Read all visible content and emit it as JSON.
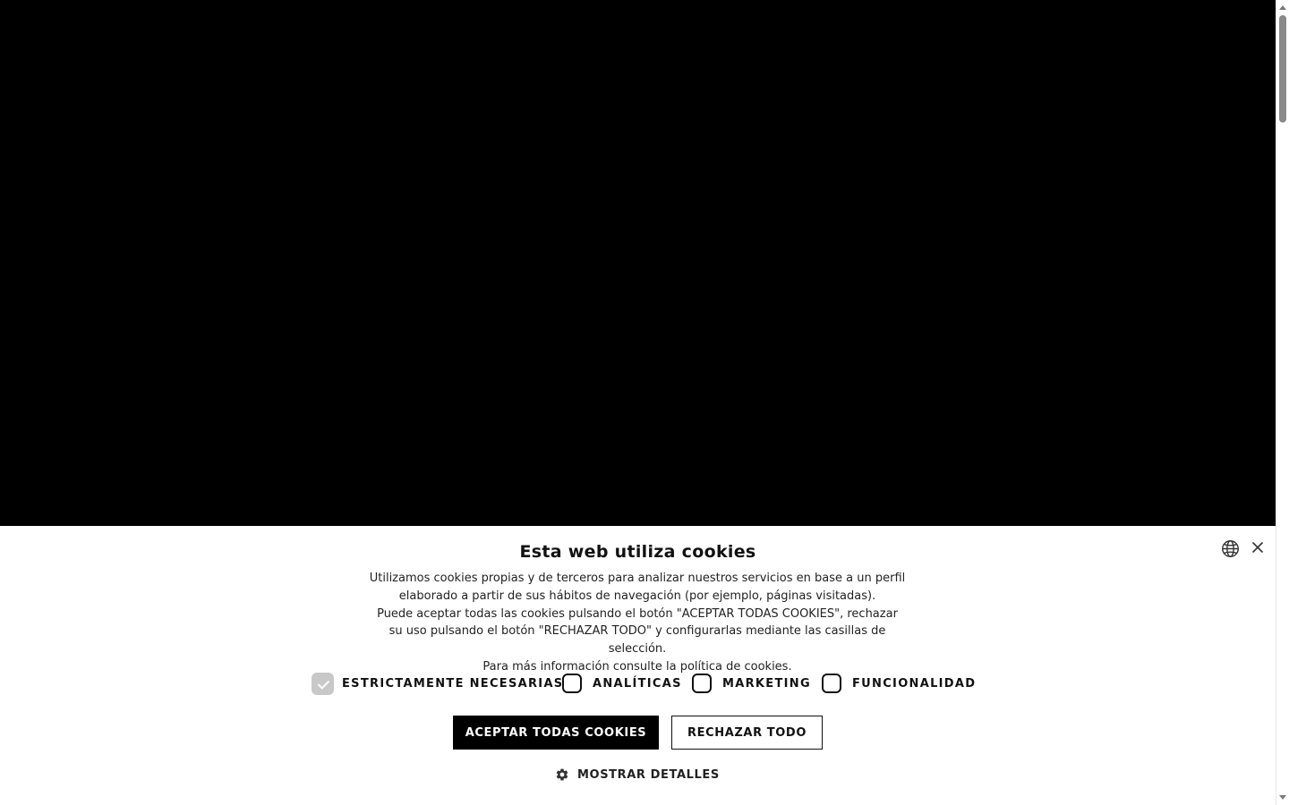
{
  "banner": {
    "title": "Esta web utiliza cookies",
    "paragraphs": [
      "Utilizamos cookies propias y de terceros para analizar nuestros servicios en base a un perfil elaborado a partir de sus hábitos de navegación (por ejemplo, páginas visitadas).",
      "Puede aceptar todas las cookies pulsando el botón \"ACEPTAR TODAS COOKIES\", rechazar su uso pulsando el botón \"RECHAZAR TODO\" y configurarlas mediante las casillas de selección.",
      "Para más información consulte la política de cookies."
    ],
    "language_icon": "globe-icon",
    "close_icon": "close-icon"
  },
  "categories": [
    {
      "label": "ESTRICTAMENTE NECESARIAS",
      "checked": true,
      "disabled": true
    },
    {
      "label": "ANALÍTICAS",
      "checked": false,
      "disabled": false
    },
    {
      "label": "MARKETING",
      "checked": false,
      "disabled": false
    },
    {
      "label": "FUNCIONALIDAD",
      "checked": false,
      "disabled": false
    }
  ],
  "buttons": {
    "accept_all": "ACEPTAR TODAS COOKIES",
    "reject_all": "RECHAZAR TODO"
  },
  "details": {
    "label": "MOSTRAR DETALLES",
    "icon": "gear-icon"
  },
  "colors": {
    "hero_background": "#000000",
    "banner_background": "#ffffff",
    "primary_button": "#000000",
    "disabled_checkbox": "#c8c8c8"
  }
}
